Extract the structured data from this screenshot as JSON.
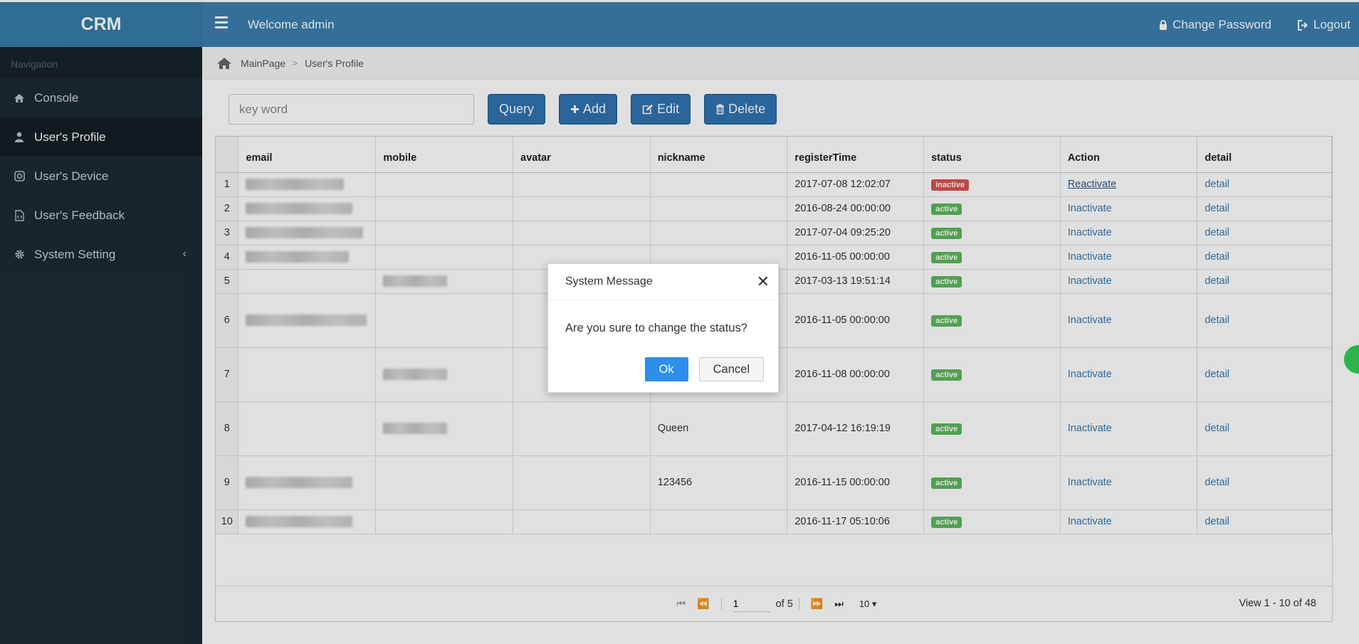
{
  "header": {
    "brand": "CRM",
    "welcome": "Welcome admin",
    "change_password": "Change Password",
    "logout": "Logout"
  },
  "sidebar": {
    "nav_label": "Navigation",
    "items": [
      {
        "label": "Console",
        "icon": "home-icon"
      },
      {
        "label": "User's Profile",
        "icon": "user-icon"
      },
      {
        "label": "User's Device",
        "icon": "instagram-icon"
      },
      {
        "label": "User's Feedback",
        "icon": "file-code-icon"
      },
      {
        "label": "System Setting",
        "icon": "gear-icon"
      }
    ]
  },
  "breadcrumb": {
    "home": "MainPage",
    "current": "User's Profile"
  },
  "toolbar": {
    "search_placeholder": "key word",
    "query": "Query",
    "add": "Add",
    "edit": "Edit",
    "delete": "Delete"
  },
  "grid": {
    "columns": [
      "email",
      "mobile",
      "avatar",
      "nickname",
      "registerTime",
      "status",
      "Action",
      "detail"
    ],
    "rows": [
      {
        "n": "1",
        "nickname": "",
        "registerTime": "2017-07-08 12:02:07",
        "status": "inactive",
        "action": "Reactivate",
        "detail": "detail"
      },
      {
        "n": "2",
        "nickname": "",
        "registerTime": "2016-08-24 00:00:00",
        "status": "active",
        "action": "Inactivate",
        "detail": "detail"
      },
      {
        "n": "3",
        "nickname": "",
        "registerTime": "2017-07-04 09:25:20",
        "status": "active",
        "action": "Inactivate",
        "detail": "detail"
      },
      {
        "n": "4",
        "nickname": "",
        "registerTime": "2016-11-05 00:00:00",
        "status": "active",
        "action": "Inactivate",
        "detail": "detail"
      },
      {
        "n": "5",
        "nickname": "",
        "registerTime": "2017-03-13 19:51:14",
        "status": "active",
        "action": "Inactivate",
        "detail": "detail"
      },
      {
        "n": "6",
        "nickname": "",
        "registerTime": "2016-11-05 00:00:00",
        "status": "active",
        "action": "Inactivate",
        "detail": "detail"
      },
      {
        "n": "7",
        "nickname": "",
        "registerTime": "2016-11-08 00:00:00",
        "status": "active",
        "action": "Inactivate",
        "detail": "detail"
      },
      {
        "n": "8",
        "nickname": "Queen",
        "registerTime": "2017-04-12 16:19:19",
        "status": "active",
        "action": "Inactivate",
        "detail": "detail"
      },
      {
        "n": "9",
        "nickname": "123456",
        "registerTime": "2016-11-15 00:00:00",
        "status": "active",
        "action": "Inactivate",
        "detail": "detail"
      },
      {
        "n": "10",
        "nickname": "",
        "registerTime": "2016-11-17 05:10:06",
        "status": "active",
        "action": "Inactivate",
        "detail": "detail"
      }
    ]
  },
  "pager": {
    "page": "1",
    "of_pages": "of 5",
    "page_size": "10 ▾",
    "view": "View 1 - 10 of 48"
  },
  "dialog": {
    "title": "System Message",
    "message": "Are you sure to change the status?",
    "ok": "Ok",
    "cancel": "Cancel"
  },
  "colors": {
    "topbar": "#3c7fb0",
    "sidebar": "#1d2b33",
    "primary_button": "#2f72b1",
    "active_badge": "#5cb85c",
    "inactive_badge": "#d9534f",
    "ok_button": "#2e8ded"
  }
}
